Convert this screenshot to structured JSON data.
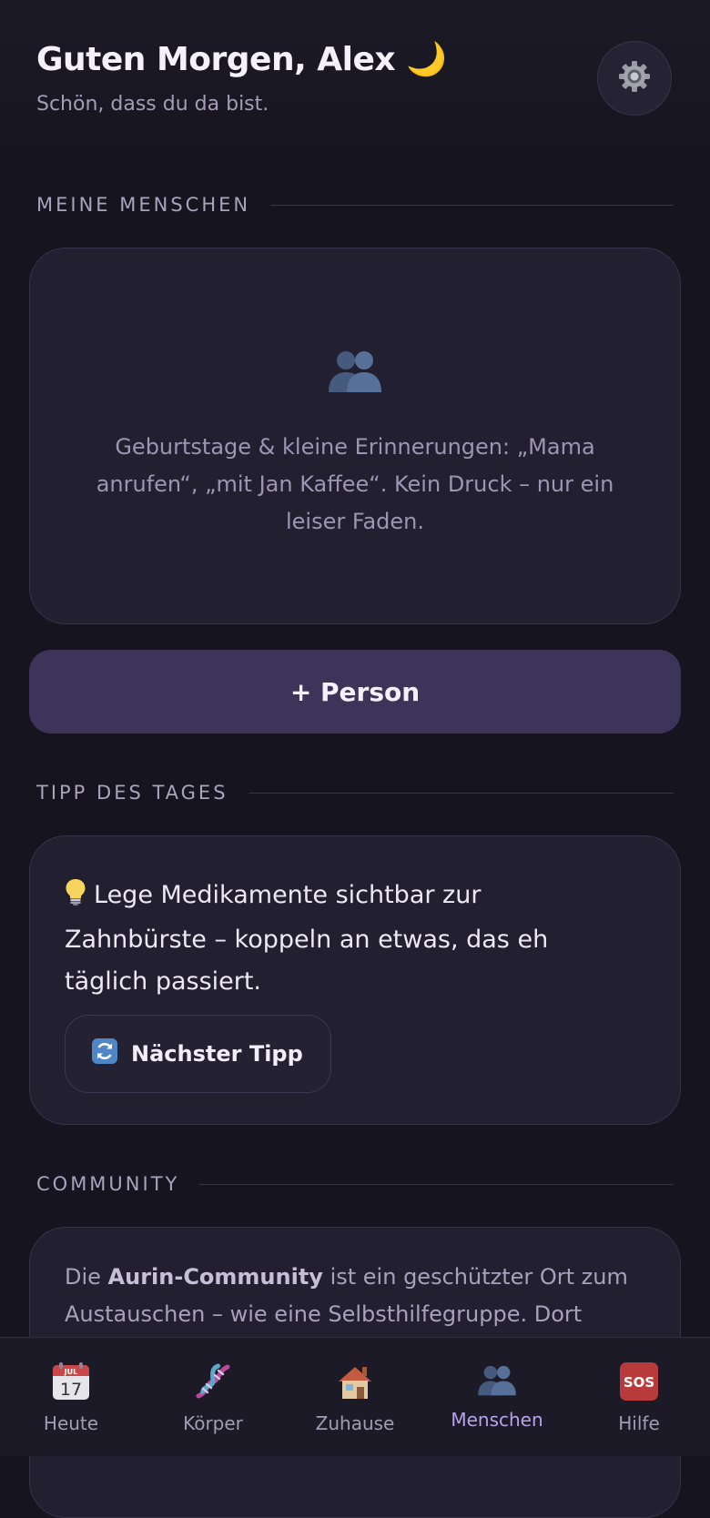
{
  "header": {
    "greeting": "Guten Morgen, Alex",
    "greeting_emoji": "🌙",
    "subline": "Schön, dass du da bist.",
    "settings_icon": "gear-icon"
  },
  "people": {
    "section_label": "MEINE MENSCHEN",
    "empty_icon": "people-icon",
    "empty_text": "Geburtstage & kleine Erinnerungen: „Mama anrufen“, „mit Jan Kaffee“. Kein Druck – nur ein leiser Faden.",
    "add_button_label": "+ Person"
  },
  "tip": {
    "section_label": "TIPP DES TAGES",
    "icon": "lightbulb-icon",
    "text": "Lege Medikamente sichtbar zur Zahnbürste – koppeln an etwas, das eh täglich passiert.",
    "next_button_label": "Nächster Tipp",
    "next_button_icon": "refresh-icon"
  },
  "community": {
    "section_label": "COMMUNITY",
    "text_before": "Die ",
    "text_bold": "Aurin-Community",
    "text_after": " ist ein geschützter Ort zum Austauschen – wie eine Selbsthilfegruppe. Dort"
  },
  "nav": {
    "active": "Menschen",
    "items": [
      {
        "label": "Heute",
        "icon": "calendar-icon",
        "calendar_month": "JUL",
        "calendar_day": "17"
      },
      {
        "label": "Körper",
        "icon": "dna-icon"
      },
      {
        "label": "Zuhause",
        "icon": "house-icon"
      },
      {
        "label": "Menschen",
        "icon": "people-icon"
      },
      {
        "label": "Hilfe",
        "icon": "sos-icon",
        "badge_text": "SOS"
      }
    ]
  },
  "colors": {
    "background": "#16141f",
    "card": "#221f30",
    "accent": "#b7a3ec",
    "primary_button": "#3d3459",
    "sos_red": "#b83a3a"
  }
}
